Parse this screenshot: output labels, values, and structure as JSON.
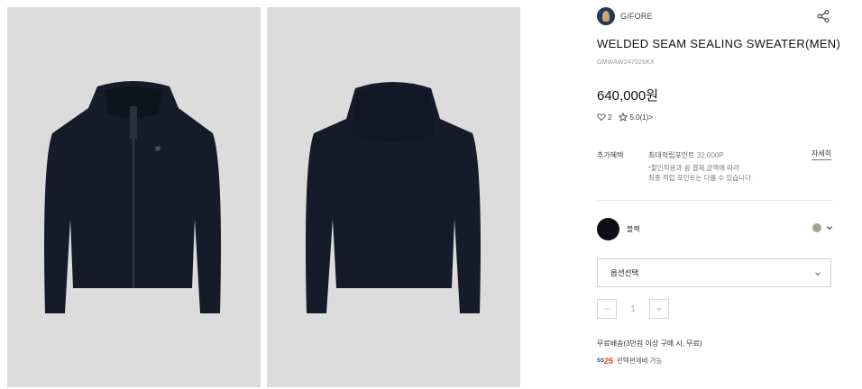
{
  "product": {
    "brand": "G/FORE",
    "title": "WELDED SEAM SEALING SWEATER(MEN)",
    "code": "GMWAW247026KX",
    "price": "640,000원"
  },
  "stats": {
    "likes": "2",
    "rating": "5.0(1)",
    "rating_suffix": ">"
  },
  "benefit": {
    "label": "추가혜택",
    "points_label": "최대적립포인트",
    "points_value": "32,000P",
    "note_line1": "*할인적용과 쉼 결제 금액에 따라",
    "note_line2": "최종 적립 포인트는 다를 수 있습니다.",
    "detail_link": "자세히"
  },
  "color": {
    "name": "블랙",
    "swatch": "#0d0f14",
    "alt_swatch": "#a7a68c"
  },
  "option": {
    "placeholder": "옵션선택"
  },
  "quantity": {
    "minus": "−",
    "value": "1",
    "plus": "+"
  },
  "shipping": {
    "text": "무료배송(3만원 이상 구매 시, 무료)",
    "badge_prefix": "SS",
    "badge_num": "25",
    "delivery_text": "런택편제배 가능"
  },
  "icons": [
    "share-icon",
    "heart-icon",
    "star-icon",
    "chevron-down-icon"
  ]
}
